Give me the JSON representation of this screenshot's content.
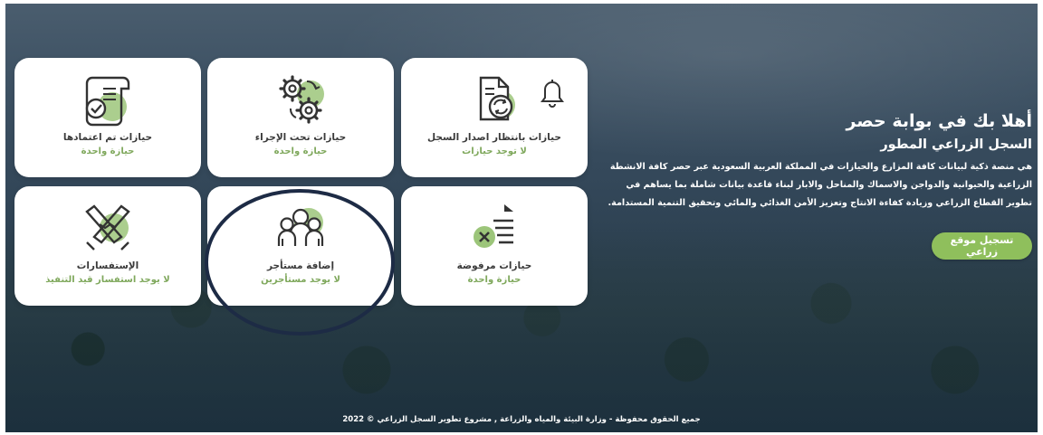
{
  "welcome": {
    "title": "أهلا بك في بوابة حصر",
    "subtitle": "السجل الزراعي المطور",
    "description": "هي منصة ذكية لبيانات كافة المزارع والحيازات في المملكة العربية السعودية عبر حصر كافة الانشطة الزراعية والحيوانية والدواجن والاسماك والمناحل والابار لبناء قاعدة بيانات شاملة بما يساهم في تطوير القطاع الزراعي وزيادة كفاءة الانتاج وتعزيز الأمن الغذائي والمائي وتحقيق التنمية المستدامة.",
    "register_label": "تسجيل موقع زراعي"
  },
  "cards": [
    {
      "title": "حيازات تم اعتمادها",
      "sub": "حيازة واحدة",
      "icon": "approved-document-icon"
    },
    {
      "title": "حيازات تحت الإجراء",
      "sub": "حيازة واحدة",
      "icon": "gears-process-icon"
    },
    {
      "title": "حيازات بانتظار اصدار السجل",
      "sub": "لا توجد حيازات",
      "icon": "pending-record-icon"
    },
    {
      "title": "الإستفسارات",
      "sub": "لا يوجد استفسار قيد التنفيذ",
      "icon": "handshake-inquiries-icon"
    },
    {
      "title": "إضافة مستأجر",
      "sub": "لا يوجد مستأجرين",
      "icon": "tenants-group-icon"
    },
    {
      "title": "حيازات مرفوضة",
      "sub": "حيازة واحدة",
      "icon": "rejected-list-icon"
    }
  ],
  "footer": {
    "text": "جميع الحقوق محفوظة - وزارة البيئة والمياه والزراعة , مشروع تطوير السجل الزراعي © 2022"
  },
  "colors": {
    "accent_green": "#8fbf5c",
    "sub_text_green": "#7fa85c",
    "annotation_circle": "#1d2b45"
  }
}
